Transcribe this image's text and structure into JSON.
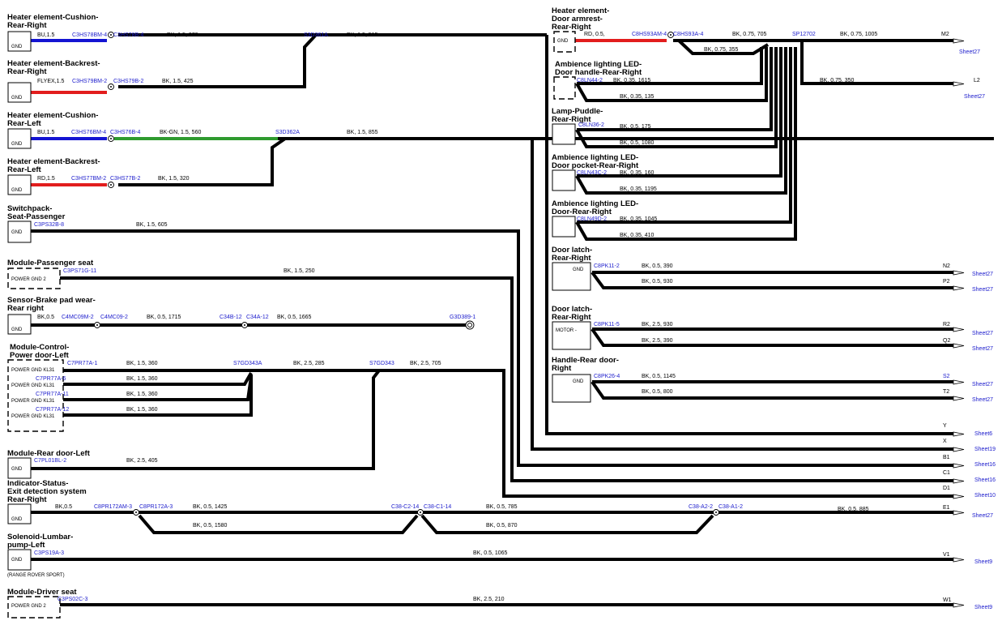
{
  "components": [
    {
      "id": "c1",
      "title": [
        "Heater element-Cushion-",
        "Rear-Right"
      ],
      "box": "GND"
    },
    {
      "id": "c2",
      "title": [
        "Heater element-Backrest-",
        "Rear-Right"
      ],
      "box": "GND"
    },
    {
      "id": "c3",
      "title": [
        "Heater element-Cushion-",
        "Rear-Left"
      ],
      "box": "GND"
    },
    {
      "id": "c4",
      "title": [
        "Heater element-Backrest-",
        "Rear-Left"
      ],
      "box": "GND"
    },
    {
      "id": "c5",
      "title": [
        "Switchpack-",
        "Seat-Passenger"
      ],
      "box": "GND"
    },
    {
      "id": "c6",
      "title": [
        "Module-Passenger seat"
      ],
      "box": "POWER GND 2"
    },
    {
      "id": "c7",
      "title": [
        "Sensor-Brake pad wear-",
        "Rear right"
      ],
      "box": "GND"
    },
    {
      "id": "c8",
      "title": [
        "Module-Control-",
        "Power door-Left"
      ],
      "box": "POWER GND KL31"
    },
    {
      "id": "c9",
      "title": [
        "Module-Rear door-Left"
      ],
      "box": "GND"
    },
    {
      "id": "c10",
      "title": [
        "Indicator-Status-",
        "Exit detection system",
        "Rear-Right"
      ],
      "box": "GND"
    },
    {
      "id": "c11",
      "title": [
        "Solenoid-Lumbar-",
        "pump-Left"
      ],
      "box": "GND",
      "note": "(RANGE ROVER SPORT)"
    },
    {
      "id": "c12",
      "title": [
        "Module-Driver seat"
      ],
      "box": "POWER GND 2"
    },
    {
      "id": "c13",
      "title": [
        "Heater element-",
        "Door armrest-",
        "Rear-Right"
      ],
      "box": "GND"
    },
    {
      "id": "c14",
      "title": [
        "Ambience lighting LED-",
        "Door handle-Rear-Right"
      ],
      "box": ""
    },
    {
      "id": "c15",
      "title": [
        "Lamp-Puddle-",
        "Rear-Right"
      ],
      "box": ""
    },
    {
      "id": "c16",
      "title": [
        "Ambience lighting LED-",
        "Door pocket-Rear-Right"
      ],
      "box": ""
    },
    {
      "id": "c17",
      "title": [
        "Ambience lighting LED-",
        "Door-Rear-Right"
      ],
      "box": ""
    },
    {
      "id": "c18",
      "title": [
        "Door latch-",
        "Rear-Right"
      ],
      "box": "GND"
    },
    {
      "id": "c19",
      "title": [
        "Door latch-",
        "Rear-Right"
      ],
      "box": "MOTOR -"
    },
    {
      "id": "c20",
      "title": [
        "Handle-Rear door-",
        "Right"
      ],
      "box": "GND"
    }
  ],
  "c8_box_rows": [
    "POWER GND KL31",
    "POWER GND KL31",
    "POWER GND KL31",
    "POWER GND KL31"
  ],
  "connectors": {
    "c1a": "C3HS78BM-4",
    "c1b": "C3HS78B-4",
    "s1": "S3D361A",
    "c2a": "C3HS79BM-2",
    "c2b": "C3HS79B-2",
    "c3a": "C3HS76BM-4",
    "c3b": "C3HS76B-4",
    "s2": "S3D362A",
    "c4a": "C3HS77BM-2",
    "c4b": "C3HS77B-2",
    "c5": "C3PS32B-8",
    "c6": "C3PS71G-11",
    "c7a": "C4MC09M-2",
    "c7b": "C4MC09-2",
    "c7c": "C34B-12",
    "c7d": "C34A-12",
    "g7": "G3D389-1",
    "c8a": "C7PR77A-1",
    "c8b": "C7PR77A-6",
    "c8c": "C7PR77A-11",
    "c8d": "C7PR77A-12",
    "s8a": "S7GD343A",
    "s8b": "S7GD343",
    "c9": "C7PL01BL-2",
    "c10a": "C8PR172AM-3",
    "c10b": "C8PR172A-3",
    "c10c": "C38-C2-14",
    "c10d": "C38-C1-14",
    "c10e": "C38-A2-2",
    "c10f": "C38-A1-2",
    "c11": "C3PS19A-3",
    "c12": "C3PS02C-3",
    "c13a": "C8HS93AM-4",
    "c13b": "C8HS93A-4",
    "sp": "SP12702",
    "c14": "C8LN44-2",
    "c15": "C8LN36-2",
    "c16": "C8LN43C-2",
    "c17": "C8LN49D-2",
    "c18": "C8PK11-2",
    "c19": "C8PK11-5",
    "c20": "C8PK26-4"
  },
  "wire_labels": {
    "w1a": "BU,1.5",
    "w1b": "BK, 1.5, 370",
    "w1c": "BK, 1.5, 515",
    "w2a": "FLYEX,1.5",
    "w2b": "BK, 1.5, 425",
    "w3a": "BU,1.5",
    "w3b": "BK-GN, 1.5, 560",
    "w3c": "BK, 1.5, 855",
    "w4a": "RD,1.5",
    "w4b": "BK, 1.5, 320",
    "w5": "BK, 1.5, 605",
    "w6": "BK, 1.5, 250",
    "w7a": "BK,0.5",
    "w7b": "BK, 0.5, 1715",
    "w7c": "BK, 0.5, 1665",
    "w8a": "BK, 1.5, 360",
    "w8b": "BK, 1.5, 360",
    "w8c": "BK, 1.5, 360",
    "w8d": "BK, 1.5, 360",
    "w8e": "BK, 2.5, 285",
    "w8f": "BK, 2.5, 705",
    "w9": "BK, 2.5, 405",
    "w10a": "BK,0.5",
    "w10b": "BK, 0.5, 1425",
    "w10c": "BK, 0.5, 1580",
    "w10d": "BK, 0.5, 785",
    "w10e": "BK, 0.5, 870",
    "w10f": "BK, 0.5, 885",
    "w11": "BK, 0.5, 1065",
    "w12": "BK, 2.5, 210",
    "w13a": "RD, 0.5,",
    "w13b": "BK, 0.75, 705",
    "w13c": "BK, 0.75, 355",
    "w13d": "BK, 0.75, 1005",
    "w13e": "BK, 0.75, 350",
    "w14a": "BK, 0.35, 1615",
    "w14b": "BK, 0.35, 135",
    "w15a": "BK, 0.5, 175",
    "w15b": "BK, 0.5, 1080",
    "w16a": "BK, 0.35, 160",
    "w16b": "BK, 0.35, 1195",
    "w17a": "BK, 0.35, 1045",
    "w17b": "BK, 0.35, 410",
    "w18a": "BK, 0.5, 390",
    "w18b": "BK, 0.5, 930",
    "w19a": "BK, 2.5, 930",
    "w19b": "BK, 2.5, 390",
    "w20a": "BK, 0.5, 1145",
    "w20b": "BK, 0.5, 800"
  },
  "offsheet": [
    {
      "ref": "M2",
      "sheet": "Sheet27"
    },
    {
      "ref": "L2",
      "sheet": "Sheet27"
    },
    {
      "ref": "N2",
      "sheet": "Sheet27"
    },
    {
      "ref": "P2",
      "sheet": "Sheet27"
    },
    {
      "ref": "R2",
      "sheet": "Sheet27"
    },
    {
      "ref": "Q2",
      "sheet": "Sheet27"
    },
    {
      "ref": "S2",
      "sheet": "Sheet27"
    },
    {
      "ref": "T2",
      "sheet": "Sheet27"
    },
    {
      "ref": "Y",
      "sheet": "Sheet6"
    },
    {
      "ref": "X",
      "sheet": "Sheet19"
    },
    {
      "ref": "B1",
      "sheet": "Sheet16"
    },
    {
      "ref": "C1",
      "sheet": "Sheet16"
    },
    {
      "ref": "D1",
      "sheet": "Sheet10"
    },
    {
      "ref": "E1",
      "sheet": "Sheet27"
    },
    {
      "ref": "V1",
      "sheet": "Sheet9"
    },
    {
      "ref": "W1",
      "sheet": "Sheet9"
    }
  ]
}
